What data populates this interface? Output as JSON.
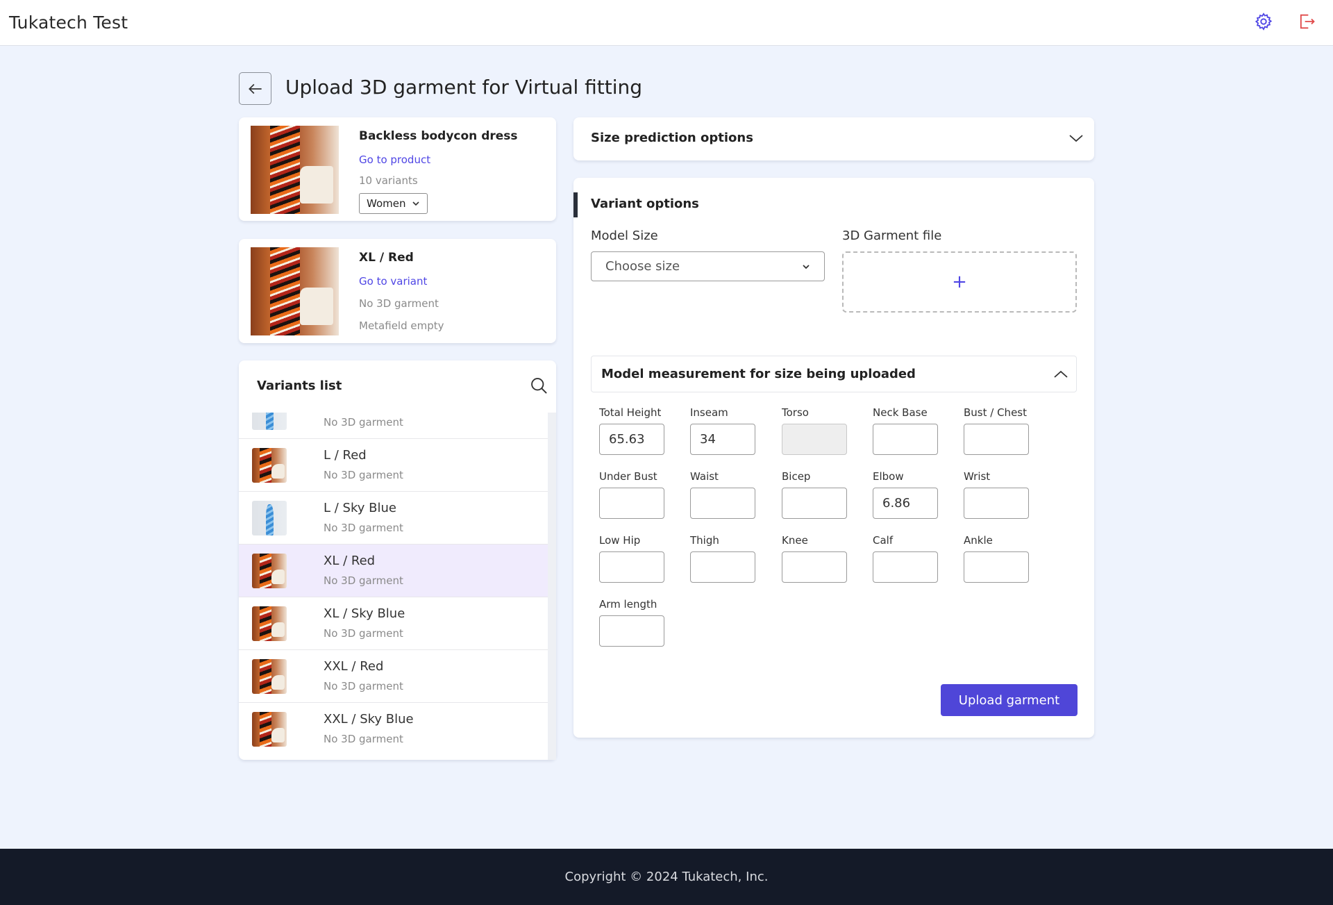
{
  "app": {
    "title": "Tukatech Test"
  },
  "header": {
    "settings_icon": "gear-icon",
    "logout_icon": "logout-icon",
    "accent": "#4f46e5",
    "logout_color": "#e04b4b"
  },
  "page": {
    "title": "Upload 3D garment for Virtual fitting",
    "back_icon": "arrow-left-icon"
  },
  "product": {
    "name": "Backless bodycon dress",
    "link": "Go to product",
    "variants_count": "10 variants",
    "gender": "Women"
  },
  "current_variant": {
    "name": "XL / Red",
    "link": "Go to variant",
    "garment_status": "No 3D garment",
    "metafield_status": "Metafield empty"
  },
  "variants_list": {
    "title": "Variants list",
    "partial_item": {
      "sub": "No 3D garment"
    },
    "items": [
      {
        "label": "L / Red",
        "sub": "No 3D garment",
        "thumb": "red"
      },
      {
        "label": "L / Sky Blue",
        "sub": "No 3D garment",
        "thumb": "blue"
      },
      {
        "label": "XL / Red",
        "sub": "No 3D garment",
        "thumb": "red",
        "selected": true
      },
      {
        "label": "XL / Sky Blue",
        "sub": "No 3D garment",
        "thumb": "red"
      },
      {
        "label": "XXL / Red",
        "sub": "No 3D garment",
        "thumb": "red"
      },
      {
        "label": "XXL / Sky Blue",
        "sub": "No 3D garment",
        "thumb": "red"
      }
    ]
  },
  "size_prediction": {
    "title": "Size prediction options"
  },
  "variant_options": {
    "title": "Variant options",
    "model_size_label": "Model Size",
    "model_size_placeholder": "Choose size",
    "garment_file_label": "3D Garment file",
    "add_symbol": "+"
  },
  "measurements": {
    "title": "Model measurement for size being uploaded",
    "fields": [
      {
        "label": "Total Height",
        "value": "65.63"
      },
      {
        "label": "Inseam",
        "value": "34"
      },
      {
        "label": "Torso",
        "value": "",
        "disabled": true
      },
      {
        "label": "Neck Base",
        "value": ""
      },
      {
        "label": "Bust / Chest",
        "value": ""
      },
      {
        "label": "Under Bust",
        "value": ""
      },
      {
        "label": "Waist",
        "value": ""
      },
      {
        "label": "Bicep",
        "value": ""
      },
      {
        "label": "Elbow",
        "value": "6.86"
      },
      {
        "label": "Wrist",
        "value": ""
      },
      {
        "label": "Low Hip",
        "value": ""
      },
      {
        "label": "Thigh",
        "value": ""
      },
      {
        "label": "Knee",
        "value": ""
      },
      {
        "label": "Calf",
        "value": ""
      },
      {
        "label": "Ankle",
        "value": ""
      },
      {
        "label": "Arm length",
        "value": ""
      }
    ],
    "upload_label": "Upload garment"
  },
  "footer": {
    "copyright": "Copyright © 2024 Tukatech, Inc."
  }
}
